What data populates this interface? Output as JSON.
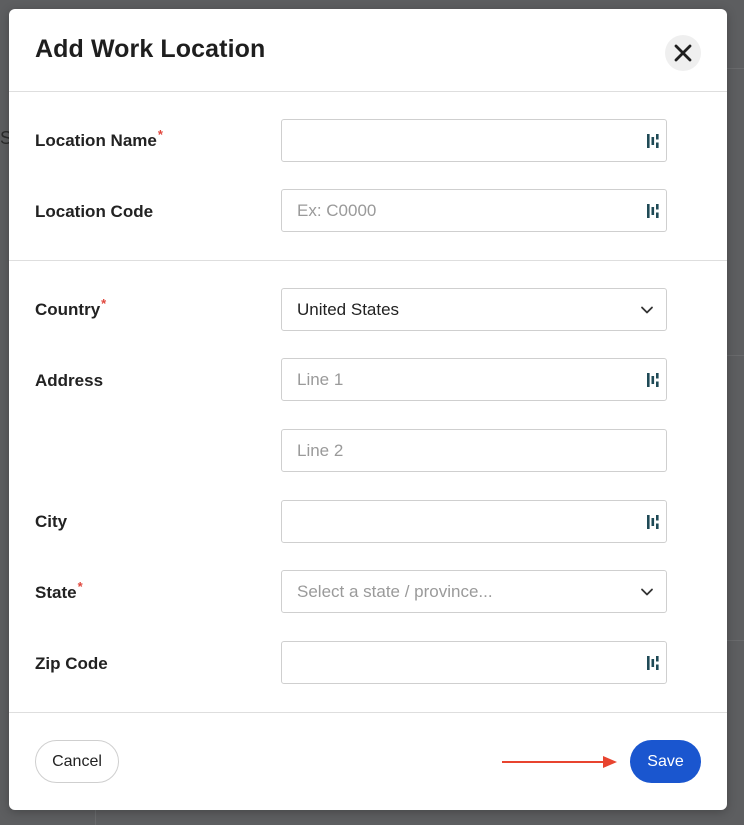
{
  "backdrop": {
    "partial_letter": "S"
  },
  "modal": {
    "title": "Add Work Location",
    "close_icon": "close-icon"
  },
  "form": {
    "location_name": {
      "label": "Location Name",
      "required": true,
      "value": "",
      "placeholder": ""
    },
    "location_code": {
      "label": "Location Code",
      "required": false,
      "value": "",
      "placeholder": "Ex: C0000"
    },
    "country": {
      "label": "Country",
      "required": true,
      "selected": "United States"
    },
    "address": {
      "label": "Address",
      "line1": {
        "value": "",
        "placeholder": "Line 1"
      },
      "line2": {
        "value": "",
        "placeholder": "Line 2"
      }
    },
    "city": {
      "label": "City",
      "value": "",
      "placeholder": ""
    },
    "state": {
      "label": "State",
      "required": true,
      "placeholder": "Select a state / province..."
    },
    "zip": {
      "label": "Zip Code",
      "value": "",
      "placeholder": ""
    }
  },
  "footer": {
    "cancel_label": "Cancel",
    "save_label": "Save",
    "annotation": "arrow pointing to Save button"
  },
  "colors": {
    "primary": "#1a56cf",
    "required_marker": "#e0463c",
    "annotation_arrow": "#e8442f",
    "overlay": "#5d5e60",
    "field_icon": "#1f4a56"
  },
  "icons": {
    "field_autofill": "autofill-icon",
    "dropdown": "chevron-down-icon"
  }
}
